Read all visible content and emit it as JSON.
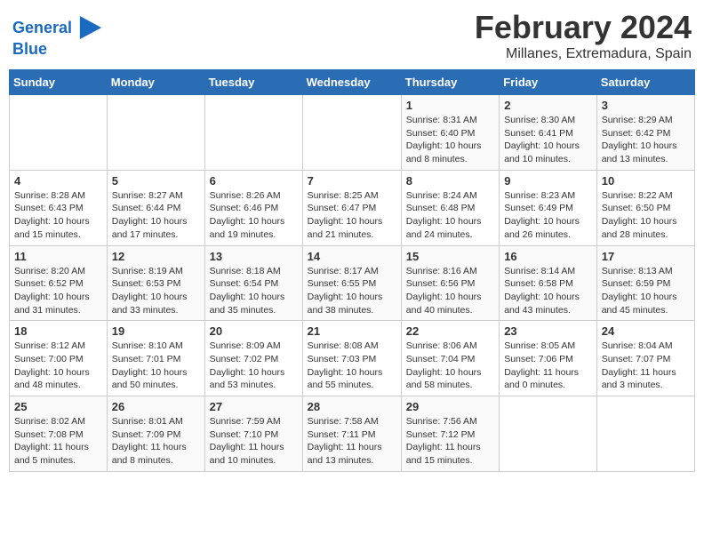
{
  "header": {
    "logo_line1": "General",
    "logo_line2": "Blue",
    "month_year": "February 2024",
    "location": "Millanes, Extremadura, Spain"
  },
  "columns": [
    "Sunday",
    "Monday",
    "Tuesday",
    "Wednesday",
    "Thursday",
    "Friday",
    "Saturday"
  ],
  "weeks": [
    [
      {
        "day": "",
        "info": ""
      },
      {
        "day": "",
        "info": ""
      },
      {
        "day": "",
        "info": ""
      },
      {
        "day": "",
        "info": ""
      },
      {
        "day": "1",
        "info": "Sunrise: 8:31 AM\nSunset: 6:40 PM\nDaylight: 10 hours\nand 8 minutes."
      },
      {
        "day": "2",
        "info": "Sunrise: 8:30 AM\nSunset: 6:41 PM\nDaylight: 10 hours\nand 10 minutes."
      },
      {
        "day": "3",
        "info": "Sunrise: 8:29 AM\nSunset: 6:42 PM\nDaylight: 10 hours\nand 13 minutes."
      }
    ],
    [
      {
        "day": "4",
        "info": "Sunrise: 8:28 AM\nSunset: 6:43 PM\nDaylight: 10 hours\nand 15 minutes."
      },
      {
        "day": "5",
        "info": "Sunrise: 8:27 AM\nSunset: 6:44 PM\nDaylight: 10 hours\nand 17 minutes."
      },
      {
        "day": "6",
        "info": "Sunrise: 8:26 AM\nSunset: 6:46 PM\nDaylight: 10 hours\nand 19 minutes."
      },
      {
        "day": "7",
        "info": "Sunrise: 8:25 AM\nSunset: 6:47 PM\nDaylight: 10 hours\nand 21 minutes."
      },
      {
        "day": "8",
        "info": "Sunrise: 8:24 AM\nSunset: 6:48 PM\nDaylight: 10 hours\nand 24 minutes."
      },
      {
        "day": "9",
        "info": "Sunrise: 8:23 AM\nSunset: 6:49 PM\nDaylight: 10 hours\nand 26 minutes."
      },
      {
        "day": "10",
        "info": "Sunrise: 8:22 AM\nSunset: 6:50 PM\nDaylight: 10 hours\nand 28 minutes."
      }
    ],
    [
      {
        "day": "11",
        "info": "Sunrise: 8:20 AM\nSunset: 6:52 PM\nDaylight: 10 hours\nand 31 minutes."
      },
      {
        "day": "12",
        "info": "Sunrise: 8:19 AM\nSunset: 6:53 PM\nDaylight: 10 hours\nand 33 minutes."
      },
      {
        "day": "13",
        "info": "Sunrise: 8:18 AM\nSunset: 6:54 PM\nDaylight: 10 hours\nand 35 minutes."
      },
      {
        "day": "14",
        "info": "Sunrise: 8:17 AM\nSunset: 6:55 PM\nDaylight: 10 hours\nand 38 minutes."
      },
      {
        "day": "15",
        "info": "Sunrise: 8:16 AM\nSunset: 6:56 PM\nDaylight: 10 hours\nand 40 minutes."
      },
      {
        "day": "16",
        "info": "Sunrise: 8:14 AM\nSunset: 6:58 PM\nDaylight: 10 hours\nand 43 minutes."
      },
      {
        "day": "17",
        "info": "Sunrise: 8:13 AM\nSunset: 6:59 PM\nDaylight: 10 hours\nand 45 minutes."
      }
    ],
    [
      {
        "day": "18",
        "info": "Sunrise: 8:12 AM\nSunset: 7:00 PM\nDaylight: 10 hours\nand 48 minutes."
      },
      {
        "day": "19",
        "info": "Sunrise: 8:10 AM\nSunset: 7:01 PM\nDaylight: 10 hours\nand 50 minutes."
      },
      {
        "day": "20",
        "info": "Sunrise: 8:09 AM\nSunset: 7:02 PM\nDaylight: 10 hours\nand 53 minutes."
      },
      {
        "day": "21",
        "info": "Sunrise: 8:08 AM\nSunset: 7:03 PM\nDaylight: 10 hours\nand 55 minutes."
      },
      {
        "day": "22",
        "info": "Sunrise: 8:06 AM\nSunset: 7:04 PM\nDaylight: 10 hours\nand 58 minutes."
      },
      {
        "day": "23",
        "info": "Sunrise: 8:05 AM\nSunset: 7:06 PM\nDaylight: 11 hours\nand 0 minutes."
      },
      {
        "day": "24",
        "info": "Sunrise: 8:04 AM\nSunset: 7:07 PM\nDaylight: 11 hours\nand 3 minutes."
      }
    ],
    [
      {
        "day": "25",
        "info": "Sunrise: 8:02 AM\nSunset: 7:08 PM\nDaylight: 11 hours\nand 5 minutes."
      },
      {
        "day": "26",
        "info": "Sunrise: 8:01 AM\nSunset: 7:09 PM\nDaylight: 11 hours\nand 8 minutes."
      },
      {
        "day": "27",
        "info": "Sunrise: 7:59 AM\nSunset: 7:10 PM\nDaylight: 11 hours\nand 10 minutes."
      },
      {
        "day": "28",
        "info": "Sunrise: 7:58 AM\nSunset: 7:11 PM\nDaylight: 11 hours\nand 13 minutes."
      },
      {
        "day": "29",
        "info": "Sunrise: 7:56 AM\nSunset: 7:12 PM\nDaylight: 11 hours\nand 15 minutes."
      },
      {
        "day": "",
        "info": ""
      },
      {
        "day": "",
        "info": ""
      }
    ]
  ]
}
